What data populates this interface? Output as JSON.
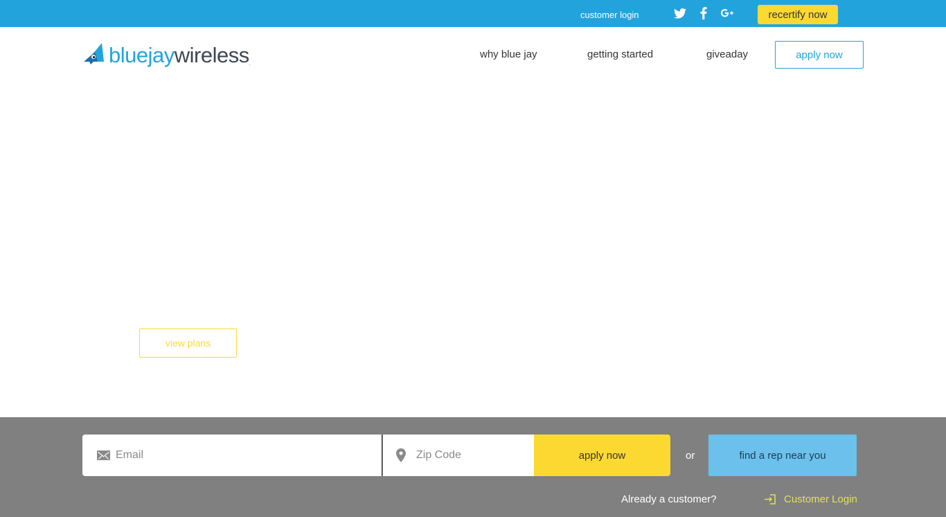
{
  "topbar": {
    "customer_login": "customer login",
    "social": [
      "twitter-icon",
      "facebook-icon",
      "google-plus-icon"
    ],
    "recertify": "recertify now"
  },
  "brand": {
    "name_blue": "bluejay",
    "name_dark": "wireless",
    "trademark": "."
  },
  "nav": {
    "items": [
      "why blue jay",
      "getting started",
      "giveaday"
    ],
    "apply": "apply now"
  },
  "hero": {
    "view_plans": "view plans"
  },
  "signup": {
    "email_placeholder": "Email",
    "zip_placeholder": "Zip Code",
    "apply": "apply now",
    "or": "or",
    "find_rep": "find a rep near you",
    "already_customer": "Already a customer?",
    "customer_login": "Customer Login"
  },
  "colors": {
    "brand_blue": "#23a3dc",
    "accent_yellow": "#fcd931",
    "footer_gray": "#808080",
    "rep_blue": "#6bc1ec"
  }
}
